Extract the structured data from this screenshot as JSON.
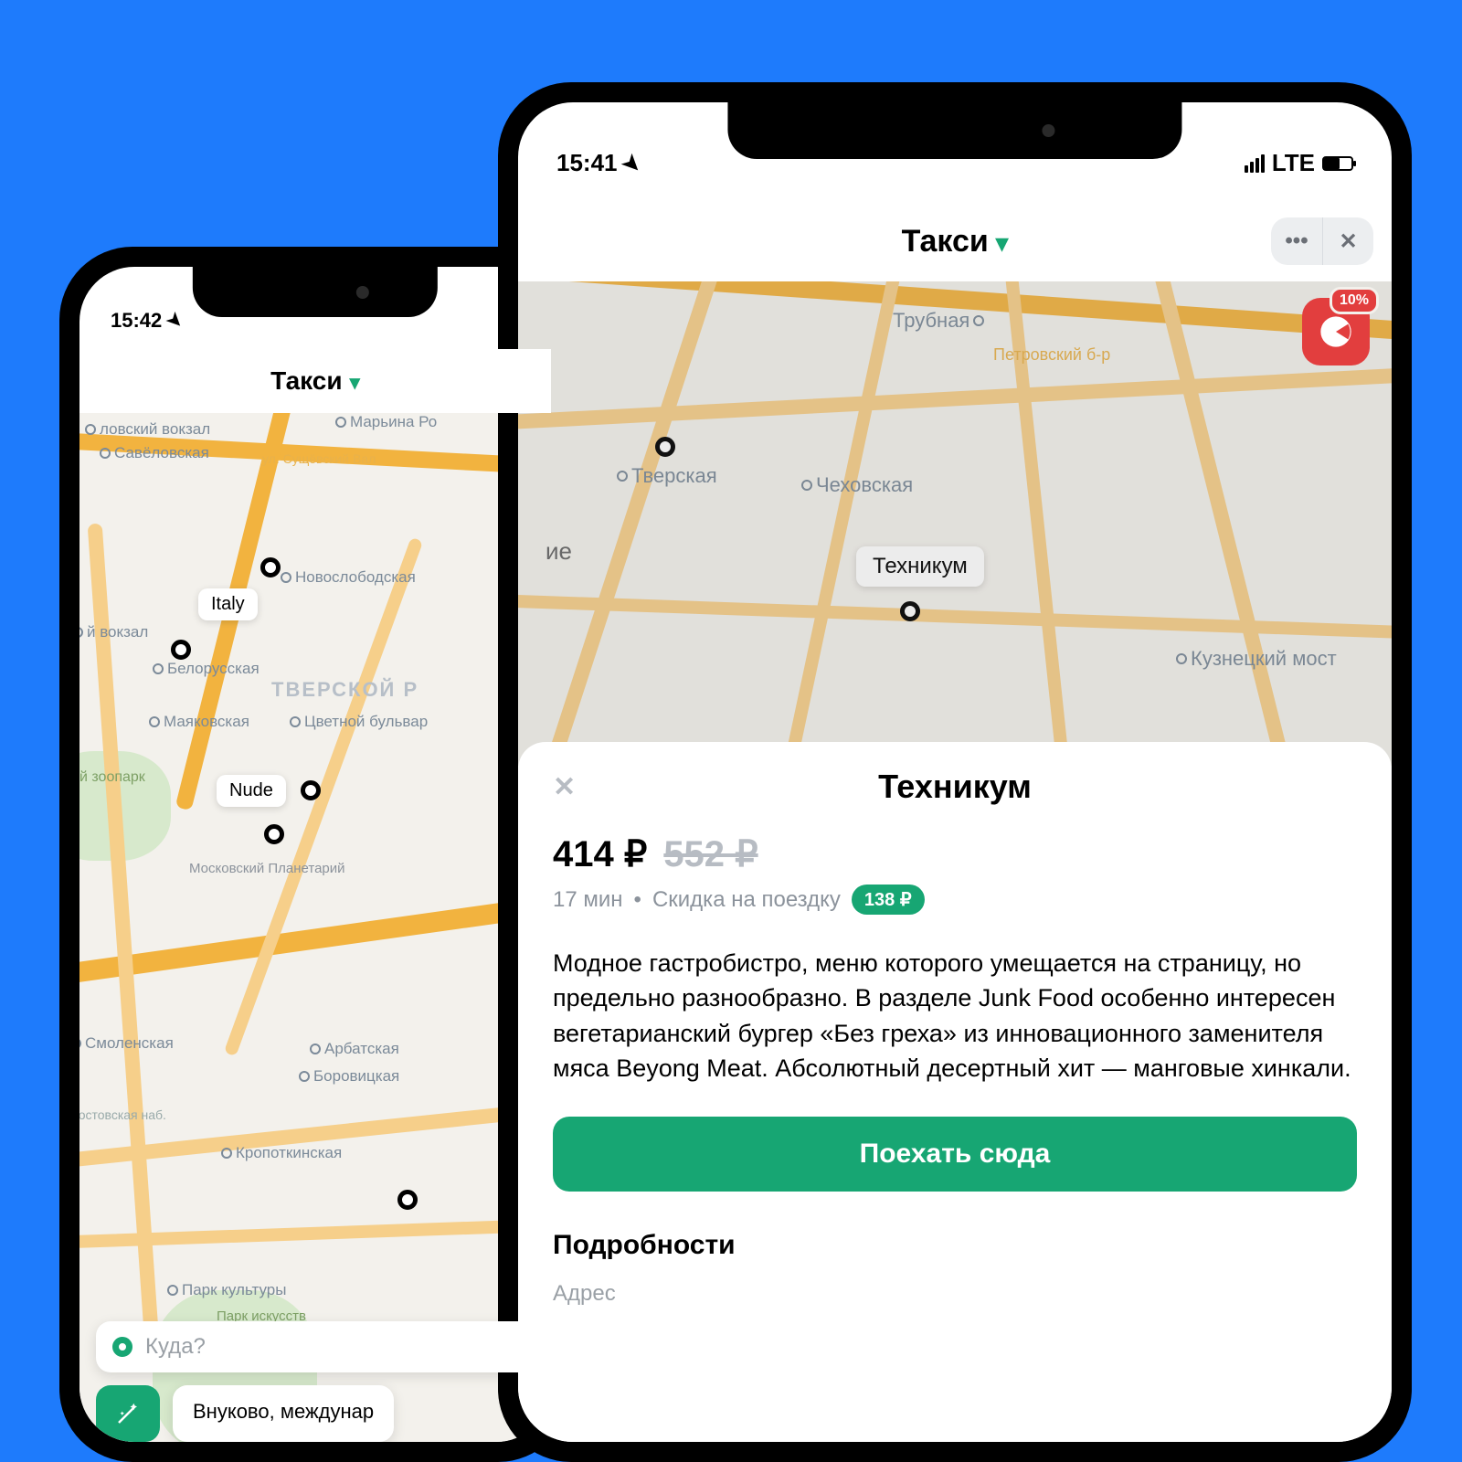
{
  "status": {
    "timeA": "15:42",
    "timeB": "15:41",
    "net": "LTE"
  },
  "header": {
    "title": "Такси"
  },
  "promo": {
    "pct": "10%"
  },
  "mapA": {
    "pois": {
      "italy": "Italy",
      "nude": "Nude"
    },
    "metros": [
      "Савёловская",
      "Марьина Ро",
      "Новослободская",
      "Белорусская",
      "Маяковская",
      "Цветной бульвар",
      "Арбатская",
      "Боровицкая",
      "Кропоткинская",
      "Парк культуры",
      "Смоленская"
    ],
    "labels": {
      "tverskoy": "ТВЕРСКОЙ Р",
      "zoo": "й зоопарк",
      "museon": "Парк искусств\nМУЗЕОН",
      "planet": "Московский Планетарий",
      "street": "ул. Сущёвский Вал",
      "station1": "ловский вокзал",
      "station2": "й вокзал",
      "rost": "Ростовская наб."
    }
  },
  "mapB": {
    "poi": "Техникум",
    "metros": [
      "Трубная",
      "Тверская",
      "Чеховская",
      "Кузнецкий мост"
    ],
    "labels": {
      "petrovsky": "Петровский б-р",
      "ie": "ие"
    }
  },
  "bottomA": {
    "placeholder": "Куда?",
    "chip": "Внуково, междунар"
  },
  "sheet": {
    "title": "Техникум",
    "price": "414 ₽",
    "old": "552 ₽",
    "time": "17 мин",
    "sep": "•",
    "discLabel": "Скидка на поездку",
    "disc": "138 ₽",
    "desc": "Модное гастробистро, меню которого умещается на страницу, но предельно разнообразно. В разделе Junk Food особенно интересен вегетарианский бургер «Без греха» из инновационного заменителя мяса Beyong Meat. Абсолютный десертный хит — манговые хинкали.",
    "cta": "Поехать сюда",
    "section": "Подробности",
    "addr": "Адрес"
  }
}
